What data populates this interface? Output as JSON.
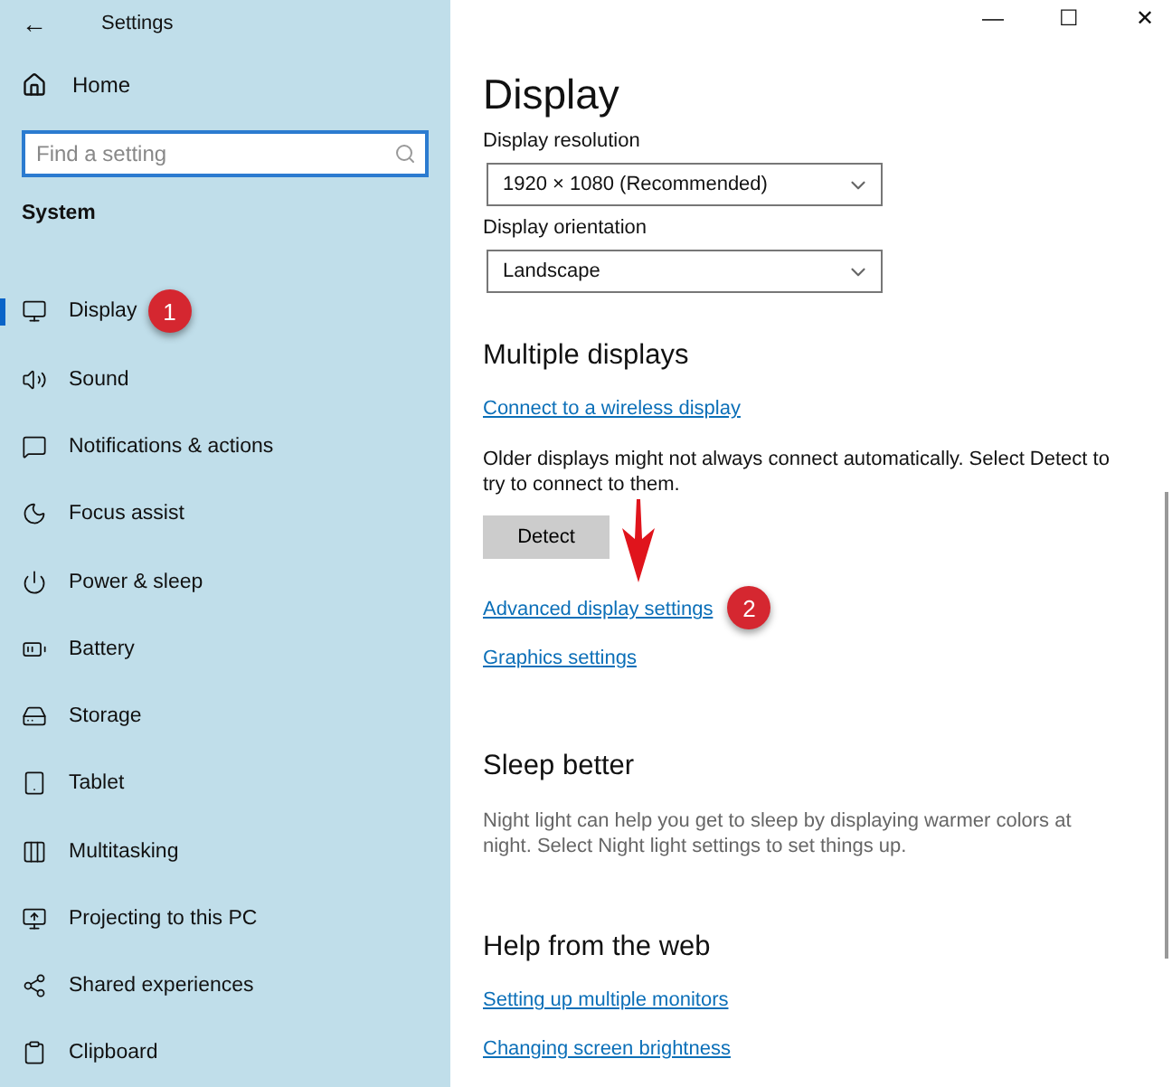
{
  "window": {
    "title": "Settings",
    "back": "←",
    "controls": [
      "—",
      "☐",
      "✕"
    ]
  },
  "sidebar": {
    "home": "Home",
    "search": {
      "placeholder": "Find a setting"
    },
    "section": "System",
    "items": [
      {
        "label": "Display",
        "selected": true,
        "badge": "1"
      },
      {
        "label": "Sound",
        "selected": false
      },
      {
        "label": "Notifications & actions",
        "selected": false
      },
      {
        "label": "Focus assist",
        "selected": false
      },
      {
        "label": "Power & sleep",
        "selected": false
      },
      {
        "label": "Battery",
        "selected": false
      },
      {
        "label": "Storage",
        "selected": false
      },
      {
        "label": "Tablet",
        "selected": false
      },
      {
        "label": "Multitasking",
        "selected": false
      },
      {
        "label": "Projecting to this PC",
        "selected": false
      },
      {
        "label": "Shared experiences",
        "selected": false
      },
      {
        "label": "Clipboard",
        "selected": false
      }
    ]
  },
  "main": {
    "title": "Display",
    "fields": [
      {
        "label": "Display resolution",
        "value": "1920 × 1080 (Recommended)"
      },
      {
        "label": "Display orientation",
        "value": "Landscape"
      }
    ],
    "sections": [
      {
        "heading": "Multiple displays",
        "blocks": [
          {
            "kind": "link",
            "text": "Connect to a wireless display"
          },
          {
            "kind": "text",
            "text": "Older displays might not always connect automatically. Select Detect to try to connect to them."
          },
          {
            "kind": "button",
            "text": "Detect"
          },
          {
            "kind": "link",
            "text": "Advanced display settings",
            "badge": "2"
          },
          {
            "kind": "link",
            "text": "Graphics settings"
          }
        ]
      },
      {
        "heading": "Sleep better",
        "blocks": [
          {
            "kind": "muted",
            "text": "Night light can help you get to sleep by displaying warmer colors at night. Select Night light settings to set things up."
          }
        ]
      },
      {
        "heading": "Help from the web",
        "blocks": [
          {
            "kind": "link",
            "text": "Setting up multiple monitors"
          },
          {
            "kind": "link",
            "text": "Changing screen brightness"
          }
        ]
      }
    ]
  }
}
